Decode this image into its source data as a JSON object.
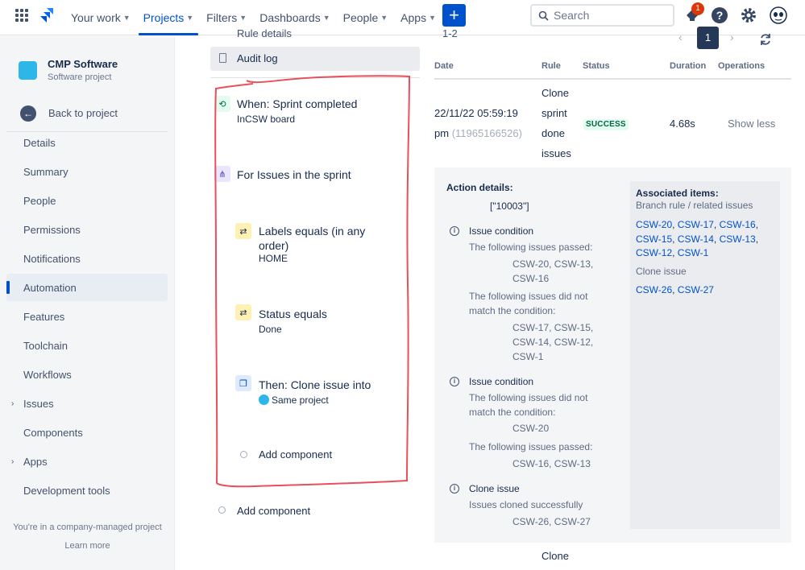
{
  "topnav": {
    "items": [
      {
        "label": "Your work",
        "active": false
      },
      {
        "label": "Projects",
        "active": true
      },
      {
        "label": "Filters",
        "active": false
      },
      {
        "label": "Dashboards",
        "active": false
      },
      {
        "label": "People",
        "active": false
      },
      {
        "label": "Apps",
        "active": false
      }
    ],
    "create_label": "+",
    "search_placeholder": "Search",
    "notification_count": "1"
  },
  "sidebar": {
    "project_name": "CMP Software",
    "project_type": "Software project",
    "back_label": "Back to project",
    "items": [
      {
        "label": "Details"
      },
      {
        "label": "Summary"
      },
      {
        "label": "People"
      },
      {
        "label": "Permissions"
      },
      {
        "label": "Notifications"
      },
      {
        "label": "Automation",
        "selected": true
      },
      {
        "label": "Features"
      },
      {
        "label": "Toolchain"
      },
      {
        "label": "Workflows"
      },
      {
        "label": "Issues",
        "expandable": true
      },
      {
        "label": "Components"
      },
      {
        "label": "Apps",
        "expandable": true
      },
      {
        "label": "Development tools"
      }
    ],
    "footer_text": "You're in a company-managed project",
    "footer_link": "Learn more"
  },
  "rule": {
    "partial_header": "Rule details",
    "audit_log_label": "Audit log",
    "trigger": {
      "title": "When: Sprint completed",
      "sub_prefix": "In",
      "sub_value": "CSW board"
    },
    "branch": {
      "title": "For Issues in the sprint"
    },
    "condition1": {
      "title_line1": "Labels equals (in any",
      "title_line2": "order)",
      "sub": "HOME"
    },
    "condition2": {
      "title": "Status equals",
      "sub": "Done"
    },
    "action": {
      "title": "Then: Clone issue into",
      "sub": "Same project"
    },
    "add_component_inner": "Add component",
    "add_component_outer": "Add component"
  },
  "audit": {
    "partial_count": "1-2",
    "current_page": "1",
    "headers": {
      "date": "Date",
      "rule": "Rule",
      "status": "Status",
      "duration": "Duration",
      "operations": "Operations"
    },
    "row": {
      "date_line1": "22/11/22 05:59:19",
      "date_line2": "pm",
      "date_id": "(11965166526)",
      "rule_lines": [
        "Clone",
        "sprint",
        "done",
        "issues"
      ],
      "status": "SUCCESS",
      "duration": "4.68s",
      "operation": "Show less"
    },
    "next_row_rule": "Clone",
    "details": {
      "action_details_label": "Action details:",
      "action_details_value": "[\"10003\"]",
      "block1_title": "Issue condition",
      "block1_passed_label": "The following issues passed:",
      "block1_passed_line1": "CSW-20, CSW-13,",
      "block1_passed_line2": "CSW-16",
      "block1_failed_label_line1": "The following issues did not",
      "block1_failed_label_line2": "match the condition:",
      "block1_failed_line1": "CSW-17, CSW-15,",
      "block1_failed_line2": "CSW-14, CSW-12,",
      "block1_failed_line3": "CSW-1",
      "block2_title": "Issue condition",
      "block2_failed_label_line1": "The following issues did not",
      "block2_failed_label_line2": "match the condition:",
      "block2_failed_line1": "CSW-20",
      "block2_passed_label": "The following issues passed:",
      "block2_passed_line1": "CSW-16, CSW-13",
      "block3_title": "Clone issue",
      "block3_sub": "Issues cloned successfully",
      "block3_items": "CSW-26, CSW-27"
    },
    "associated": {
      "title": "Associated items:",
      "sub": "Branch rule / related issues",
      "branch_links": [
        "CSW-20",
        "CSW-17",
        "CSW-16",
        "CSW-15",
        "CSW-14",
        "CSW-13",
        "CSW-12",
        "CSW-1"
      ],
      "clone_label": "Clone issue",
      "clone_links": [
        "CSW-26",
        "CSW-27"
      ]
    }
  },
  "colors": {
    "brand": "#0052cc",
    "annotation": "#e8505b",
    "success": "#006644"
  }
}
